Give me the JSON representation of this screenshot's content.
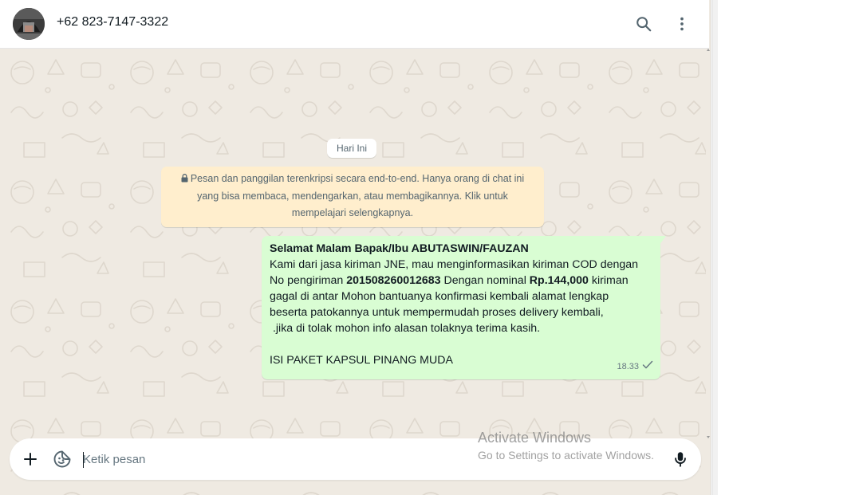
{
  "header": {
    "contact_name": "+62 823-7147-3322",
    "icons": [
      "avatar-photo",
      "search-icon",
      "more-vertical-icon"
    ]
  },
  "chat": {
    "date_chip": "Hari Ini",
    "encryption_notice": {
      "line1": "Pesan dan panggilan terenkripsi secara end-to-end. Hanya orang di chat ini",
      "line2": "yang bisa membaca, mendengarkan, atau membagikannya. Klik untuk",
      "line3": "mempelajari selengkapnya."
    },
    "message": {
      "greeting": "Selamat Malam Bapak/Ibu ABUTASWIN/FAUZAN",
      "line2": "Kami dari jasa kiriman JNE, mau menginformasikan kiriman COD dengan",
      "line3_a": "No pengiriman ",
      "tracking_no": "201508260012683",
      "line3_b": " Dengan nominal ",
      "amount": "Rp.144,000",
      "line3_c": " kiriman",
      "line4": "gagal di antar Mohon bantuanya konfirmasi kembali alamat lengkap",
      "line5": "beserta patokannya untuk mempermudah proses delivery kembali,",
      "line6": " .jika di tolak mohon info alasan tolaknya terima kasih.",
      "line7": "ISI PAKET KAPSUL PINANG MUDA",
      "time": "18.33",
      "status": "sent-single-check"
    }
  },
  "composer": {
    "placeholder": "Ketik pesan",
    "value": "",
    "icons": [
      "plus-icon",
      "sticker-icon",
      "microphone-icon"
    ]
  },
  "watermark": {
    "title": "Activate Windows",
    "subtitle": "Go to Settings to activate Windows."
  },
  "colors": {
    "chat_bg": "#efeae2",
    "outgoing_bubble": "#d9fdd3",
    "notice_bg": "#ffeecd",
    "text_primary": "#111b21",
    "text_secondary": "#54656f"
  }
}
